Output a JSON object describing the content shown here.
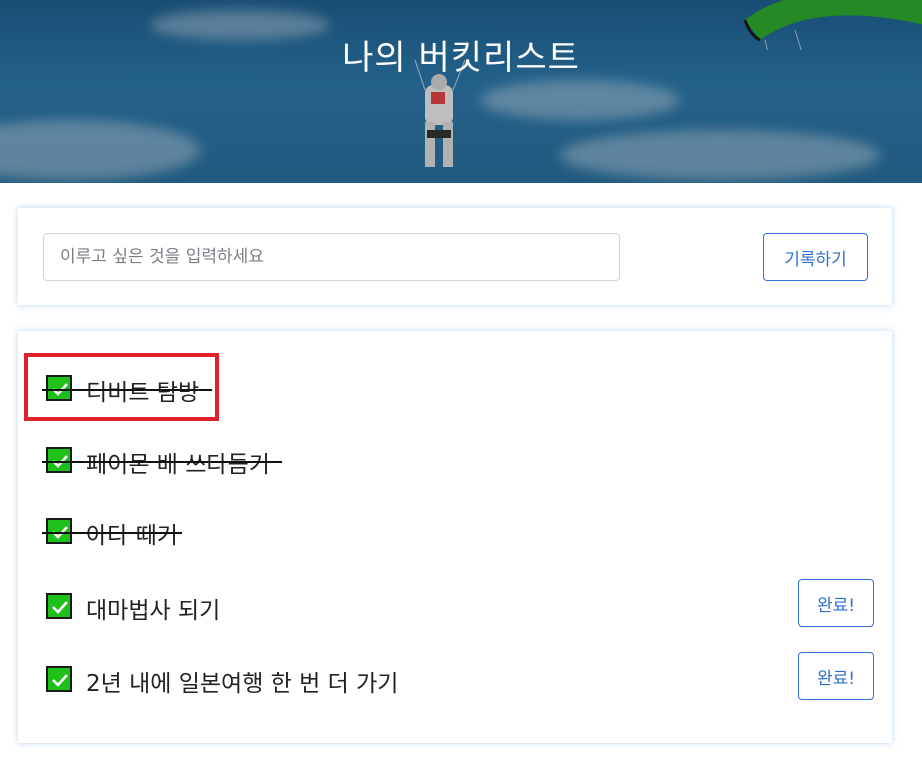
{
  "header": {
    "title": "나의 버킷리스트"
  },
  "form": {
    "placeholder": "이루고 싶은 것을 입력하세요",
    "submit_label": "기록하기"
  },
  "list": {
    "items": [
      {
        "text": "티비트 탐방",
        "done": true
      },
      {
        "text": "페이몬 배 쓰다듬기",
        "done": true
      },
      {
        "text": "아다 떼기",
        "done": true
      },
      {
        "text": "대마법사 되기",
        "done": false,
        "button": "완료!"
      },
      {
        "text": "2년 내에 일본여행 한 번 더 가기",
        "done": false,
        "button": "완료!"
      }
    ]
  },
  "colors": {
    "accent": "#2f6fd0",
    "check": "#1ec01a",
    "highlight": "#e0202a"
  }
}
